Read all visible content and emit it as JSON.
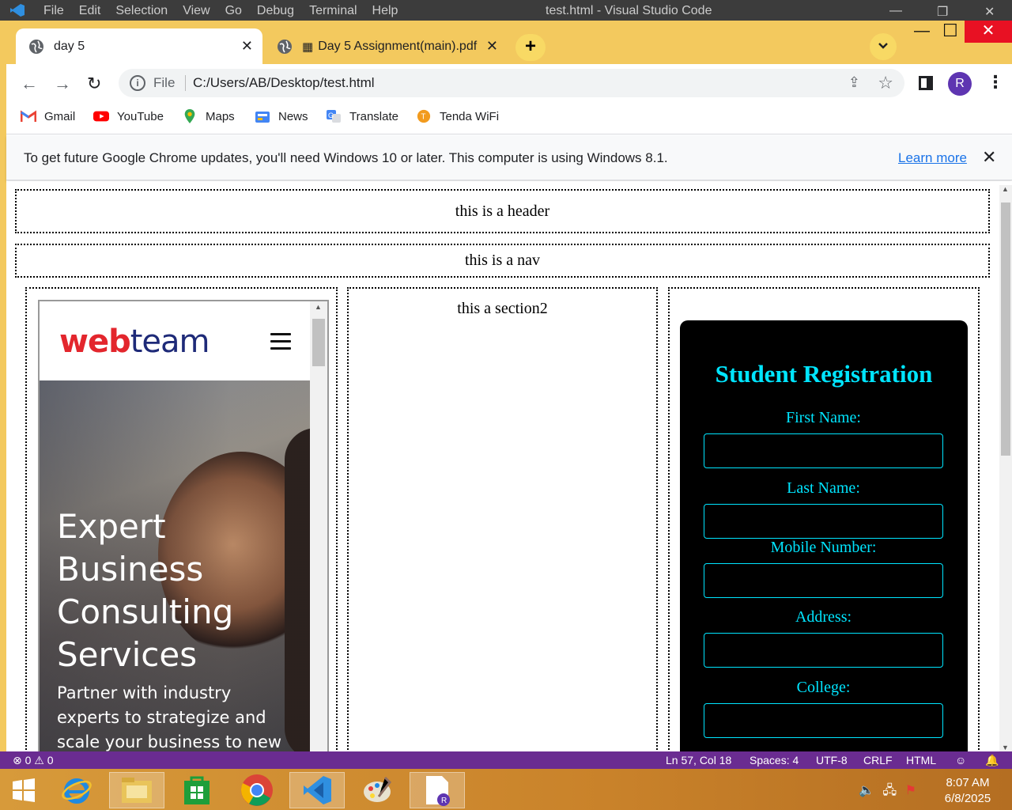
{
  "vscode": {
    "menu": [
      "File",
      "Edit",
      "Selection",
      "View",
      "Go",
      "Debug",
      "Terminal",
      "Help"
    ],
    "title": "test.html - Visual Studio Code",
    "status": {
      "problems": "⊗ 0 ⚠ 0",
      "position": "Ln 57, Col 18",
      "spaces": "Spaces: 4",
      "encoding": "UTF-8",
      "eol": "CRLF",
      "language": "HTML"
    }
  },
  "browser": {
    "tabs": [
      {
        "label": "day 5",
        "active": true
      },
      {
        "label": "Day 5 Assignment(main).pdf",
        "active": false
      }
    ],
    "new_tab": "+",
    "address": {
      "scheme_label": "File",
      "url": "C:/Users/AB/Desktop/test.html"
    },
    "profile_initial": "R",
    "bookmarks": [
      "Gmail",
      "YouTube",
      "Maps",
      "News",
      "Translate",
      "Tenda WiFi"
    ],
    "infobar": {
      "message": "To get future Google Chrome updates, you'll need Windows 10 or later. This computer is using Windows 8.1.",
      "link": "Learn more"
    }
  },
  "page": {
    "header": "this is a header",
    "nav": "this is a nav",
    "section2": "this a section2",
    "embedded_site": {
      "logo_part1": "web",
      "logo_part2": "team",
      "hero_title_lines": [
        "Expert",
        "Business",
        "Consulting",
        "Services"
      ],
      "hero_text": "Partner with industry experts to strategize and scale your business to new heights."
    },
    "form": {
      "title": "Student Registration",
      "fields": [
        "First Name:",
        "Last Name:",
        "Mobile Number:",
        "Address:",
        "College:"
      ],
      "accent_color": "#00e5ff"
    }
  },
  "taskbar": {
    "time": "8:07 AM",
    "date": "6/8/2025"
  }
}
